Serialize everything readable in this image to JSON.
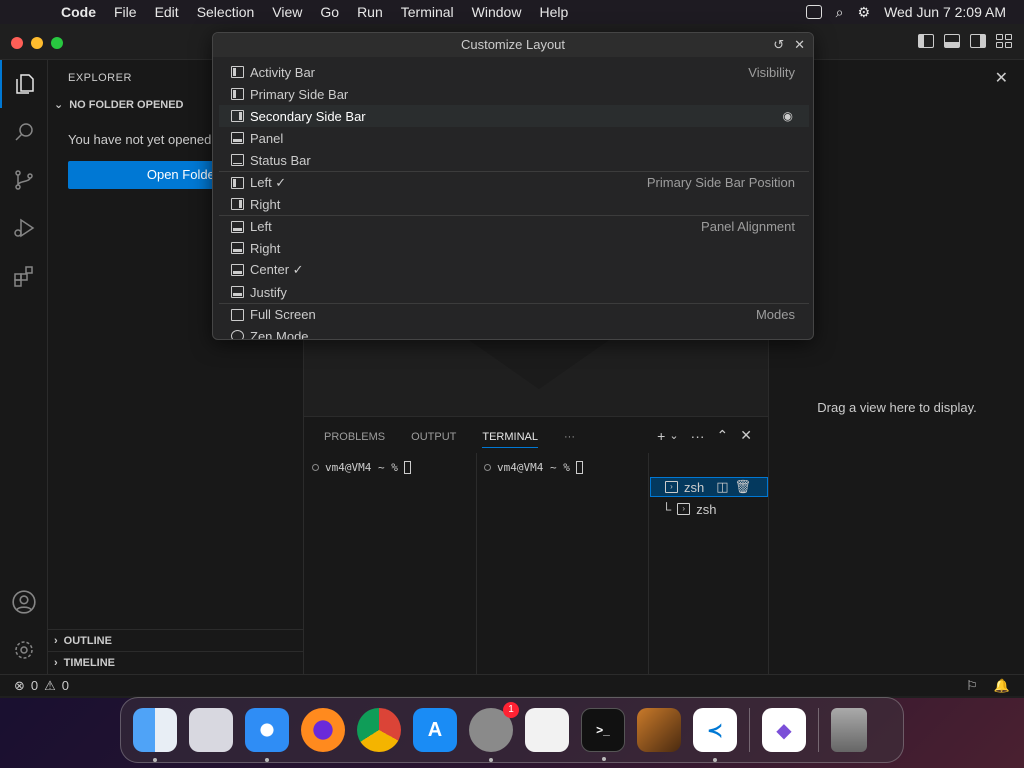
{
  "menubar": {
    "app_name": "Code",
    "items": [
      "File",
      "Edit",
      "Selection",
      "View",
      "Go",
      "Run",
      "Terminal",
      "Window",
      "Help"
    ],
    "clock": "Wed Jun 7  2:09 AM"
  },
  "sidebar": {
    "title": "EXPLORER",
    "section": "NO FOLDER OPENED",
    "message": "You have not yet opened",
    "open_folder_label": "Open Folder",
    "outline_label": "OUTLINE",
    "timeline_label": "TIMELINE"
  },
  "quickpick": {
    "title": "Customize Layout",
    "items": [
      {
        "label": "Activity Bar",
        "group": "Visibility"
      },
      {
        "label": "Primary Side Bar",
        "group": ""
      },
      {
        "label": "Secondary Side Bar",
        "group": ""
      },
      {
        "label": "Panel",
        "group": ""
      },
      {
        "label": "Status Bar",
        "group": ""
      },
      {
        "label": "Left ✓",
        "group": "Primary Side Bar Position"
      },
      {
        "label": "Right",
        "group": ""
      },
      {
        "label": "Left",
        "group": "Panel Alignment"
      },
      {
        "label": "Right",
        "group": ""
      },
      {
        "label": "Center ✓",
        "group": ""
      },
      {
        "label": "Justify",
        "group": ""
      },
      {
        "label": "Full Screen",
        "group": "Modes"
      },
      {
        "label": "Zen Mode",
        "group": ""
      }
    ]
  },
  "panel": {
    "tabs": [
      "PROBLEMS",
      "OUTPUT",
      "TERMINAL"
    ],
    "more": "···",
    "prompt1": "vm4@VM4 ~ %",
    "prompt2": "vm4@VM4 ~ %",
    "terminals": [
      "zsh",
      "zsh"
    ]
  },
  "rightbar": {
    "drag_text": "Drag a view here to display."
  },
  "statusbar": {
    "errors": "0",
    "warnings": "0"
  },
  "dock": {
    "settings_badge": "1"
  }
}
